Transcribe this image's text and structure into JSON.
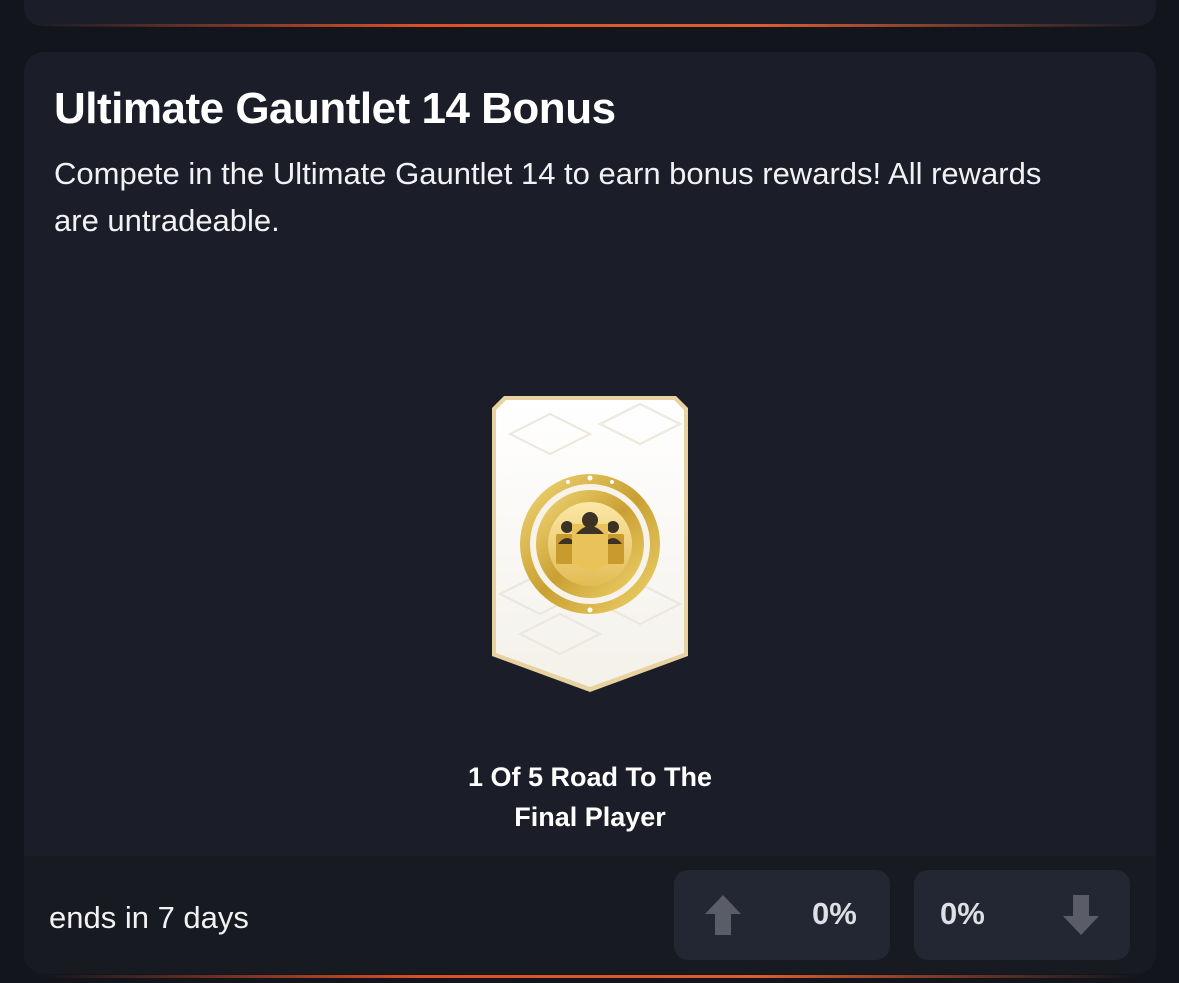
{
  "card": {
    "title": "Ultimate Gauntlet 14 Bonus",
    "description": "Compete in the Ultimate Gauntlet 14 to earn bonus rewards! All rewards are untradeable."
  },
  "reward": {
    "name_line1": "1 Of 5 Road To The",
    "name_line2": "Final Player",
    "icon": "player-pick-card-icon"
  },
  "footer": {
    "ends_text": "ends in 7 days",
    "upvote_percent": "0%",
    "downvote_percent": "0%",
    "upvote_icon": "arrow-up-icon",
    "downvote_icon": "arrow-down-icon"
  },
  "colors": {
    "page_bg": "#13151c",
    "card_bg": "#1b1e28",
    "footer_bg": "#181a22",
    "vote_bg": "#232633",
    "accent": "#ff5a2a",
    "gold": "#d9b24a",
    "arrow": "#5a5d68"
  }
}
